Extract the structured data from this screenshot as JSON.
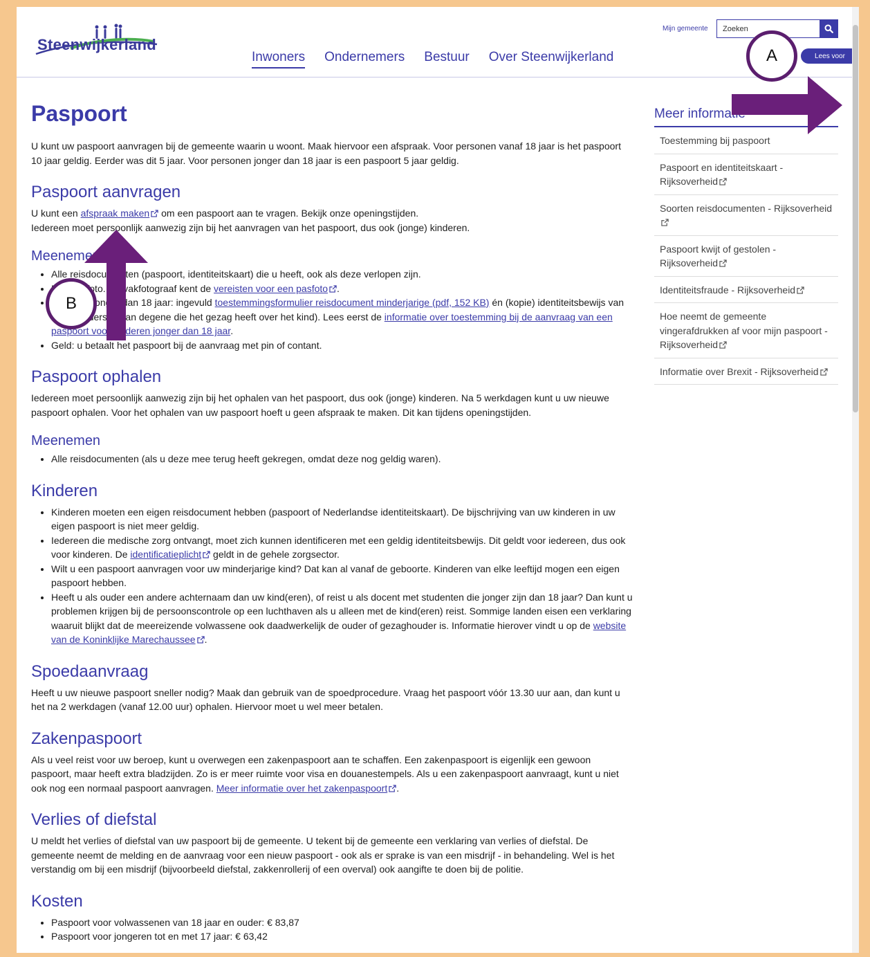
{
  "header": {
    "logo_text": "Steenwijkerland",
    "nav": [
      {
        "label": "Inwoners",
        "active": true
      },
      {
        "label": "Ondernemers"
      },
      {
        "label": "Bestuur"
      },
      {
        "label": "Over Steenwijkerland"
      }
    ],
    "mijn_gemeente": "Mijn gemeente",
    "search_placeholder": "Zoeken",
    "lees_voor": "Lees voor"
  },
  "content": {
    "title": "Paspoort",
    "intro": "U kunt uw paspoort aanvragen bij de gemeente waarin u woont. Maak hiervoor een afspraak. Voor personen vanaf 18 jaar is het paspoort 10 jaar geldig. Eerder was dit 5 jaar. Voor personen jonger dan 18 jaar is een paspoort 5 jaar geldig.",
    "aanvragen": {
      "heading": "Paspoort aanvragen",
      "p1_pre": "U kunt een ",
      "p1_link": "afspraak maken",
      "p1_post": " om een paspoort aan te vragen. Bekijk onze openingstijden.",
      "p2": "Iedereen moet persoonlijk aanwezig zijn bij het aanvragen van het paspoort, dus ook (jonge) kinderen.",
      "meenemen_heading": "Meenemen",
      "li1": "Alle reisdocumenten (paspoort, identiteitskaart) die u heeft, ook als deze verlopen zijn.",
      "li2_pre": "Een pasfoto. De vakfotograaf kent de ",
      "li2_link": "vereisten voor een pasfoto",
      "li2_post": ".",
      "li3_pre": "Kinderen jonger dan 18 jaar: ingevuld ",
      "li3_link1": "toestemmingsformulier reisdocument minderjarige (pdf, 152 KB)",
      "li3_mid": " én (kopie) identiteitsbewijs van beide ouders of van degene die het gezag heeft over het kind). Lees eerst de ",
      "li3_link2": "informatie over toestemming bij de aanvraag van een paspoort voor kinderen jonger dan 18 jaar",
      "li3_post": ".",
      "li4": "Geld: u betaalt het paspoort bij de aanvraag met pin of contant."
    },
    "ophalen": {
      "heading": "Paspoort ophalen",
      "p": "Iedereen moet persoonlijk aanwezig zijn bij het ophalen van het paspoort, dus ook (jonge) kinderen. Na 5 werkdagen kunt u uw nieuwe paspoort ophalen. Voor het ophalen van uw paspoort hoeft u geen afspraak te maken. Dit kan tijdens openingstijden.",
      "meenemen_heading": "Meenemen",
      "li1": "Alle reisdocumenten (als u deze mee terug heeft gekregen, omdat deze nog geldig waren)."
    },
    "kinderen": {
      "heading": "Kinderen",
      "li1": "Kinderen moeten een eigen reisdocument hebben (paspoort of Nederlandse identiteitskaart). De bijschrijving van uw kinderen in uw eigen paspoort is niet meer geldig.",
      "li2_pre": "Iedereen die medische zorg ontvangt, moet zich kunnen identificeren met een geldig identiteitsbewijs. Dit geldt voor iedereen, dus ook voor kinderen. De ",
      "li2_link": "identificatieplicht",
      "li2_post": " geldt in de gehele zorgsector.",
      "li3": "Wilt u een paspoort aanvragen voor uw minderjarige kind? Dat kan al vanaf de geboorte. Kinderen van elke leeftijd mogen een eigen paspoort hebben.",
      "li4_pre": "Heeft u als ouder een andere achternaam dan uw kind(eren), of reist u als docent met studenten die jonger zijn dan 18 jaar? Dan kunt u problemen krijgen bij de persoonscontrole op een luchthaven als u alleen met de kind(eren) reist. Sommige landen eisen een verklaring waaruit blijkt dat de meereizende volwassene ook daadwerkelijk de ouder of gezaghouder is. Informatie hierover vindt u op de ",
      "li4_link": "website van de Koninklijke Marechaussee",
      "li4_post": "."
    },
    "spoed": {
      "heading": "Spoedaanvraag",
      "p": "Heeft u uw nieuwe paspoort sneller nodig? Maak dan gebruik van de spoedprocedure. Vraag het paspoort vóór 13.30 uur aan, dan kunt u het na 2 werkdagen (vanaf 12.00 uur) ophalen. Hiervoor moet u wel meer betalen."
    },
    "zaken": {
      "heading": "Zakenpaspoort",
      "p_pre": "Als u veel reist voor uw beroep, kunt u overwegen een zakenpaspoort aan te schaffen. Een zakenpaspoort is eigenlijk een gewoon paspoort, maar heeft extra bladzijden. Zo is er meer ruimte voor visa en douanestempels. Als u een zakenpaspoort aanvraagt, kunt u niet ook nog een normaal paspoort aanvragen. ",
      "p_link": "Meer informatie over het zakenpaspoort",
      "p_post": "."
    },
    "verlies": {
      "heading": "Verlies of diefstal",
      "p": "U meldt het verlies of diefstal van uw paspoort bij de gemeente. U tekent bij de gemeente een verklaring van verlies of diefstal. De gemeente neemt de melding en de aanvraag voor een nieuw paspoort - ook als er sprake is van een misdrijf - in behandeling. Wel is het verstandig om bij een misdrijf (bijvoorbeeld diefstal, zakkenrollerij of een overval) ook aangifte te doen bij de politie."
    },
    "kosten": {
      "heading": "Kosten",
      "li1": "Paspoort voor volwassenen van 18 jaar en ouder: € 83,87",
      "li2": "Paspoort voor jongeren tot en met 17 jaar: € 63,42"
    }
  },
  "sidebar": {
    "title": "Meer informatie",
    "items": [
      {
        "label": "Toestemming bij paspoort",
        "external": false
      },
      {
        "label": "Paspoort en identiteitskaart - Rijksoverheid",
        "external": true
      },
      {
        "label": "Soorten reisdocumenten - Rijksoverheid",
        "external": true
      },
      {
        "label": "Paspoort kwijt of gestolen - Rijksoverheid",
        "external": true
      },
      {
        "label": "Identiteitsfraude - Rijksoverheid",
        "external": true
      },
      {
        "label": "Hoe neemt de gemeente vingerafdrukken af voor mijn paspoort - Rijksoverheid",
        "external": true
      },
      {
        "label": "Informatie over Brexit - Rijksoverheid",
        "external": true
      }
    ]
  },
  "annotations": {
    "a": "A",
    "b": "B",
    "color": "#6a1f7a"
  }
}
